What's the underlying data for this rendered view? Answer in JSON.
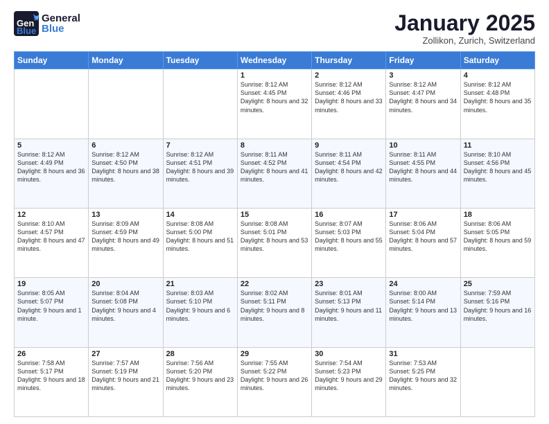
{
  "header": {
    "logo_general": "General",
    "logo_blue": "Blue",
    "month_title": "January 2025",
    "location": "Zollikon, Zurich, Switzerland"
  },
  "days_of_week": [
    "Sunday",
    "Monday",
    "Tuesday",
    "Wednesday",
    "Thursday",
    "Friday",
    "Saturday"
  ],
  "weeks": [
    [
      {
        "day": "",
        "sunrise": "",
        "sunset": "",
        "daylight": ""
      },
      {
        "day": "",
        "sunrise": "",
        "sunset": "",
        "daylight": ""
      },
      {
        "day": "",
        "sunrise": "",
        "sunset": "",
        "daylight": ""
      },
      {
        "day": "1",
        "sunrise": "Sunrise: 8:12 AM",
        "sunset": "Sunset: 4:45 PM",
        "daylight": "Daylight: 8 hours and 32 minutes."
      },
      {
        "day": "2",
        "sunrise": "Sunrise: 8:12 AM",
        "sunset": "Sunset: 4:46 PM",
        "daylight": "Daylight: 8 hours and 33 minutes."
      },
      {
        "day": "3",
        "sunrise": "Sunrise: 8:12 AM",
        "sunset": "Sunset: 4:47 PM",
        "daylight": "Daylight: 8 hours and 34 minutes."
      },
      {
        "day": "4",
        "sunrise": "Sunrise: 8:12 AM",
        "sunset": "Sunset: 4:48 PM",
        "daylight": "Daylight: 8 hours and 35 minutes."
      }
    ],
    [
      {
        "day": "5",
        "sunrise": "Sunrise: 8:12 AM",
        "sunset": "Sunset: 4:49 PM",
        "daylight": "Daylight: 8 hours and 36 minutes."
      },
      {
        "day": "6",
        "sunrise": "Sunrise: 8:12 AM",
        "sunset": "Sunset: 4:50 PM",
        "daylight": "Daylight: 8 hours and 38 minutes."
      },
      {
        "day": "7",
        "sunrise": "Sunrise: 8:12 AM",
        "sunset": "Sunset: 4:51 PM",
        "daylight": "Daylight: 8 hours and 39 minutes."
      },
      {
        "day": "8",
        "sunrise": "Sunrise: 8:11 AM",
        "sunset": "Sunset: 4:52 PM",
        "daylight": "Daylight: 8 hours and 41 minutes."
      },
      {
        "day": "9",
        "sunrise": "Sunrise: 8:11 AM",
        "sunset": "Sunset: 4:54 PM",
        "daylight": "Daylight: 8 hours and 42 minutes."
      },
      {
        "day": "10",
        "sunrise": "Sunrise: 8:11 AM",
        "sunset": "Sunset: 4:55 PM",
        "daylight": "Daylight: 8 hours and 44 minutes."
      },
      {
        "day": "11",
        "sunrise": "Sunrise: 8:10 AM",
        "sunset": "Sunset: 4:56 PM",
        "daylight": "Daylight: 8 hours and 45 minutes."
      }
    ],
    [
      {
        "day": "12",
        "sunrise": "Sunrise: 8:10 AM",
        "sunset": "Sunset: 4:57 PM",
        "daylight": "Daylight: 8 hours and 47 minutes."
      },
      {
        "day": "13",
        "sunrise": "Sunrise: 8:09 AM",
        "sunset": "Sunset: 4:59 PM",
        "daylight": "Daylight: 8 hours and 49 minutes."
      },
      {
        "day": "14",
        "sunrise": "Sunrise: 8:08 AM",
        "sunset": "Sunset: 5:00 PM",
        "daylight": "Daylight: 8 hours and 51 minutes."
      },
      {
        "day": "15",
        "sunrise": "Sunrise: 8:08 AM",
        "sunset": "Sunset: 5:01 PM",
        "daylight": "Daylight: 8 hours and 53 minutes."
      },
      {
        "day": "16",
        "sunrise": "Sunrise: 8:07 AM",
        "sunset": "Sunset: 5:03 PM",
        "daylight": "Daylight: 8 hours and 55 minutes."
      },
      {
        "day": "17",
        "sunrise": "Sunrise: 8:06 AM",
        "sunset": "Sunset: 5:04 PM",
        "daylight": "Daylight: 8 hours and 57 minutes."
      },
      {
        "day": "18",
        "sunrise": "Sunrise: 8:06 AM",
        "sunset": "Sunset: 5:05 PM",
        "daylight": "Daylight: 8 hours and 59 minutes."
      }
    ],
    [
      {
        "day": "19",
        "sunrise": "Sunrise: 8:05 AM",
        "sunset": "Sunset: 5:07 PM",
        "daylight": "Daylight: 9 hours and 1 minute."
      },
      {
        "day": "20",
        "sunrise": "Sunrise: 8:04 AM",
        "sunset": "Sunset: 5:08 PM",
        "daylight": "Daylight: 9 hours and 4 minutes."
      },
      {
        "day": "21",
        "sunrise": "Sunrise: 8:03 AM",
        "sunset": "Sunset: 5:10 PM",
        "daylight": "Daylight: 9 hours and 6 minutes."
      },
      {
        "day": "22",
        "sunrise": "Sunrise: 8:02 AM",
        "sunset": "Sunset: 5:11 PM",
        "daylight": "Daylight: 9 hours and 8 minutes."
      },
      {
        "day": "23",
        "sunrise": "Sunrise: 8:01 AM",
        "sunset": "Sunset: 5:13 PM",
        "daylight": "Daylight: 9 hours and 11 minutes."
      },
      {
        "day": "24",
        "sunrise": "Sunrise: 8:00 AM",
        "sunset": "Sunset: 5:14 PM",
        "daylight": "Daylight: 9 hours and 13 minutes."
      },
      {
        "day": "25",
        "sunrise": "Sunrise: 7:59 AM",
        "sunset": "Sunset: 5:16 PM",
        "daylight": "Daylight: 9 hours and 16 minutes."
      }
    ],
    [
      {
        "day": "26",
        "sunrise": "Sunrise: 7:58 AM",
        "sunset": "Sunset: 5:17 PM",
        "daylight": "Daylight: 9 hours and 18 minutes."
      },
      {
        "day": "27",
        "sunrise": "Sunrise: 7:57 AM",
        "sunset": "Sunset: 5:19 PM",
        "daylight": "Daylight: 9 hours and 21 minutes."
      },
      {
        "day": "28",
        "sunrise": "Sunrise: 7:56 AM",
        "sunset": "Sunset: 5:20 PM",
        "daylight": "Daylight: 9 hours and 23 minutes."
      },
      {
        "day": "29",
        "sunrise": "Sunrise: 7:55 AM",
        "sunset": "Sunset: 5:22 PM",
        "daylight": "Daylight: 9 hours and 26 minutes."
      },
      {
        "day": "30",
        "sunrise": "Sunrise: 7:54 AM",
        "sunset": "Sunset: 5:23 PM",
        "daylight": "Daylight: 9 hours and 29 minutes."
      },
      {
        "day": "31",
        "sunrise": "Sunrise: 7:53 AM",
        "sunset": "Sunset: 5:25 PM",
        "daylight": "Daylight: 9 hours and 32 minutes."
      },
      {
        "day": "",
        "sunrise": "",
        "sunset": "",
        "daylight": ""
      }
    ]
  ]
}
